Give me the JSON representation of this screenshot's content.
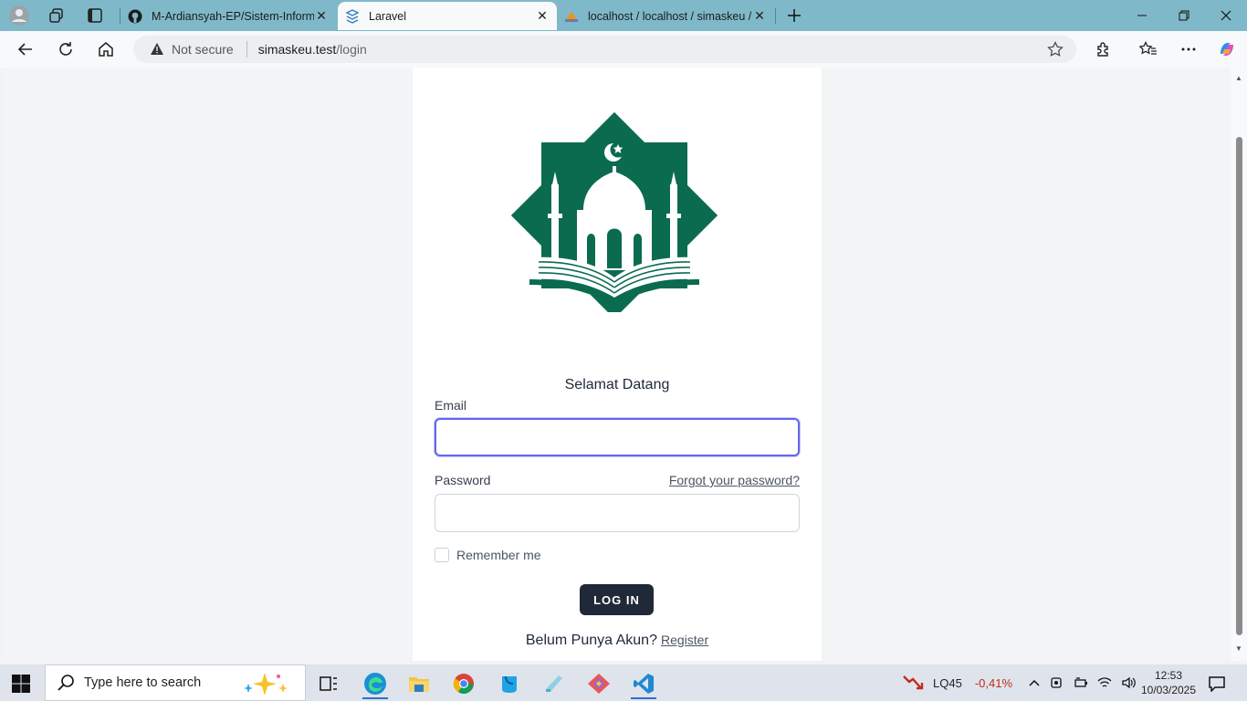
{
  "browser": {
    "tabs": [
      {
        "title": "M-Ardiansyah-EP/Sistem-Informa",
        "icon": "github-icon",
        "active": false
      },
      {
        "title": "Laravel",
        "icon": "laravel-icon",
        "active": true
      },
      {
        "title": "localhost / localhost / simaskeu /",
        "icon": "phpmyadmin-icon",
        "active": false
      }
    ],
    "security_label": "Not secure",
    "url_host": "simaskeu.test",
    "url_path": "/login"
  },
  "page": {
    "welcome": "Selamat Datang",
    "email_label": "Email",
    "email_value": "",
    "password_label": "Password",
    "password_value": "",
    "forgot_link": "Forgot your password?",
    "remember_label": "Remember me",
    "login_button": "LOG IN",
    "no_account_text": "Belum Punya Akun?",
    "register_link": "Register",
    "brand_color": "#0b6b4f",
    "focus_color": "#6366f1",
    "button_color": "#1f2937"
  },
  "taskbar": {
    "search_placeholder": "Type here to search",
    "stock_name": "LQ45",
    "stock_change": "-0,41%",
    "stock_change_color": "#c42b1c",
    "time": "12:53",
    "date": "10/03/2025",
    "apps": [
      "task-view-icon",
      "edge-icon",
      "file-explorer-icon",
      "chrome-icon",
      "app-icon",
      "notepad-icon",
      "git-icon",
      "vscode-icon"
    ]
  }
}
